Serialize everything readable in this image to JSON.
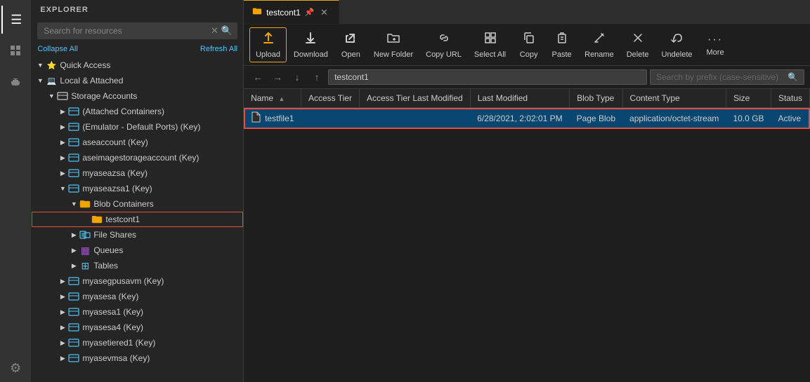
{
  "activityBar": {
    "icons": [
      {
        "name": "menu-icon",
        "symbol": "☰",
        "active": false
      },
      {
        "name": "explorer-icon",
        "symbol": "⎘",
        "active": true
      },
      {
        "name": "plugin-icon",
        "symbol": "⚡",
        "active": false
      },
      {
        "name": "settings-icon",
        "symbol": "⚙",
        "active": false
      }
    ]
  },
  "explorer": {
    "title": "EXPLORER",
    "searchPlaceholder": "Search for resources",
    "collapseAll": "Collapse All",
    "refreshAll": "Refresh All",
    "tree": [
      {
        "id": "quick-access",
        "label": "Quick Access",
        "indent": 0,
        "arrow": "open",
        "iconType": "quick"
      },
      {
        "id": "local-attached",
        "label": "Local & Attached",
        "indent": 0,
        "arrow": "open",
        "iconType": "local"
      },
      {
        "id": "storage-accounts",
        "label": "Storage Accounts",
        "indent": 1,
        "arrow": "open",
        "iconType": "folder"
      },
      {
        "id": "attached-containers",
        "label": "(Attached Containers)",
        "indent": 2,
        "arrow": "closed",
        "iconType": "storage"
      },
      {
        "id": "emulator",
        "label": "(Emulator - Default Ports) (Key)",
        "indent": 2,
        "arrow": "closed",
        "iconType": "storage"
      },
      {
        "id": "aseaccount",
        "label": "aseaccount (Key)",
        "indent": 2,
        "arrow": "closed",
        "iconType": "storage"
      },
      {
        "id": "aseimagestorageaccount",
        "label": "aseimagestorageaccount (Key)",
        "indent": 2,
        "arrow": "closed",
        "iconType": "storage"
      },
      {
        "id": "myaseazsa",
        "label": "myaseazsa (Key)",
        "indent": 2,
        "arrow": "closed",
        "iconType": "storage"
      },
      {
        "id": "myaseazsa1",
        "label": "myaseazsa1 (Key)",
        "indent": 2,
        "arrow": "open",
        "iconType": "storage"
      },
      {
        "id": "blob-containers",
        "label": "Blob Containers",
        "indent": 3,
        "arrow": "open",
        "iconType": "blob",
        "isContainer": true
      },
      {
        "id": "testcont1",
        "label": "testcont1",
        "indent": 4,
        "arrow": "leaf",
        "iconType": "blob",
        "isContainer": true,
        "selected": true,
        "redBorder": true
      },
      {
        "id": "file-shares",
        "label": "File Shares",
        "indent": 3,
        "arrow": "closed",
        "iconType": "fileshare"
      },
      {
        "id": "queues",
        "label": "Queues",
        "indent": 3,
        "arrow": "closed",
        "iconType": "queue"
      },
      {
        "id": "tables",
        "label": "Tables",
        "indent": 3,
        "arrow": "closed",
        "iconType": "table"
      },
      {
        "id": "myasegpusavm",
        "label": "myasegpusavm (Key)",
        "indent": 2,
        "arrow": "closed",
        "iconType": "storage"
      },
      {
        "id": "myasesa",
        "label": "myasesa (Key)",
        "indent": 2,
        "arrow": "closed",
        "iconType": "storage"
      },
      {
        "id": "myasesa1",
        "label": "myasesa1 (Key)",
        "indent": 2,
        "arrow": "closed",
        "iconType": "storage"
      },
      {
        "id": "myasesa4",
        "label": "myasesa4 (Key)",
        "indent": 2,
        "arrow": "closed",
        "iconType": "storage"
      },
      {
        "id": "myasetiered1",
        "label": "myasetiered1 (Key)",
        "indent": 2,
        "arrow": "closed",
        "iconType": "storage"
      },
      {
        "id": "myasevmsa",
        "label": "myasevmsa (Key)",
        "indent": 2,
        "arrow": "closed",
        "iconType": "storage"
      }
    ]
  },
  "tab": {
    "icon": "📦",
    "label": "testcont1",
    "pinned": true,
    "closeable": true
  },
  "toolbar": {
    "buttons": [
      {
        "name": "upload-button",
        "icon": "↑",
        "label": "Upload",
        "active": true
      },
      {
        "name": "download-button",
        "icon": "↓",
        "label": "Download",
        "active": false
      },
      {
        "name": "open-button",
        "icon": "↗",
        "label": "Open",
        "active": false
      },
      {
        "name": "new-folder-button",
        "icon": "+",
        "label": "New Folder",
        "active": false
      },
      {
        "name": "copy-url-button",
        "icon": "🔗",
        "label": "Copy URL",
        "active": false
      },
      {
        "name": "select-all-button",
        "icon": "⬚",
        "label": "Select All",
        "active": false
      },
      {
        "name": "copy-button",
        "icon": "⧉",
        "label": "Copy",
        "active": false
      },
      {
        "name": "paste-button",
        "icon": "📋",
        "label": "Paste",
        "active": false
      },
      {
        "name": "rename-button",
        "icon": "✏",
        "label": "Rename",
        "active": false
      },
      {
        "name": "delete-button",
        "icon": "🗑",
        "label": "Delete",
        "active": false
      },
      {
        "name": "undelete-button",
        "icon": "↩",
        "label": "Undelete",
        "active": false
      },
      {
        "name": "more-button",
        "icon": "•••",
        "label": "More",
        "active": false
      }
    ]
  },
  "navBar": {
    "backDisabled": false,
    "forwardDisabled": true,
    "upDisabled": false,
    "path": "testcont1",
    "searchPlaceholder": "Search by prefix (case-sensitive)"
  },
  "table": {
    "columns": [
      {
        "name": "name-col",
        "label": "Name",
        "sortable": true,
        "sorted": true
      },
      {
        "name": "access-tier-col",
        "label": "Access Tier",
        "sortable": false
      },
      {
        "name": "access-tier-modified-col",
        "label": "Access Tier Last Modified",
        "sortable": false
      },
      {
        "name": "last-modified-col",
        "label": "Last Modified",
        "sortable": false
      },
      {
        "name": "blob-type-col",
        "label": "Blob Type",
        "sortable": false
      },
      {
        "name": "content-type-col",
        "label": "Content Type",
        "sortable": false
      },
      {
        "name": "size-col",
        "label": "Size",
        "sortable": false
      },
      {
        "name": "status-col",
        "label": "Status",
        "sortable": false
      }
    ],
    "rows": [
      {
        "id": "testfile1",
        "name": "testfile1",
        "accessTier": "",
        "accessTierModified": "",
        "lastModified": "6/28/2021, 2:02:01 PM",
        "blobType": "Page Blob",
        "contentType": "application/octet-stream",
        "size": "10.0 GB",
        "status": "Active",
        "selected": true
      }
    ]
  }
}
